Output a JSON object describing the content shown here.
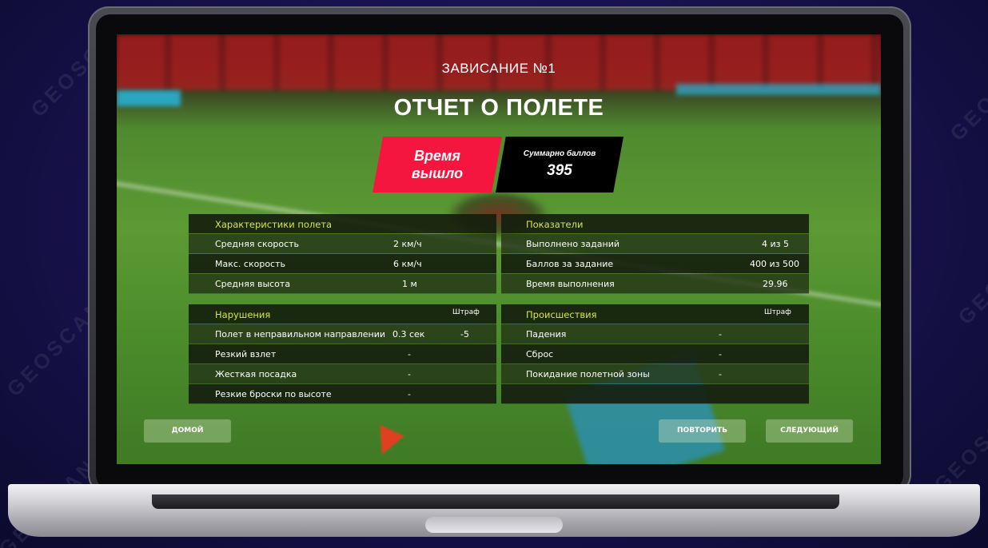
{
  "watermark": "GEOSCAN",
  "header": {
    "mission": "ЗАВИСАНИЕ №1",
    "title": "ОТЧЕТ О ПОЛЕТЕ"
  },
  "status": {
    "time_out_line1": "Время",
    "time_out_line2": "вышло",
    "score_label": "Суммарно баллов",
    "score_value": "395"
  },
  "flight_characteristics": {
    "header": "Характеристики полета",
    "rows": [
      {
        "label": "Средняя скорость",
        "value": "2 км/ч"
      },
      {
        "label": "Макс. скорость",
        "value": "6 км/ч"
      },
      {
        "label": "Средняя высота",
        "value": "1 м"
      }
    ]
  },
  "indicators": {
    "header": "Показатели",
    "rows": [
      {
        "label": "Выполнено заданий",
        "value": "4 из 5"
      },
      {
        "label": "Баллов за задание",
        "value": "400 из 500"
      },
      {
        "label": "Время выполнения",
        "value": "29.96"
      }
    ]
  },
  "violations": {
    "header": "Нарушения",
    "penalty_header": "Штраф",
    "rows": [
      {
        "label": "Полет в неправильном направлении",
        "value": "0.3 сек",
        "penalty": "-5"
      },
      {
        "label": "Резкий взлет",
        "value": "-",
        "penalty": ""
      },
      {
        "label": "Жесткая посадка",
        "value": "-",
        "penalty": ""
      },
      {
        "label": "Резкие броски по высоте",
        "value": "-",
        "penalty": ""
      }
    ]
  },
  "incidents": {
    "header": "Происшествия",
    "penalty_header": "Штраф",
    "rows": [
      {
        "label": "Падения",
        "value": "-"
      },
      {
        "label": "Сброс",
        "value": "-"
      },
      {
        "label": "Покидание полетной зоны",
        "value": "-"
      },
      {
        "label": "",
        "value": ""
      }
    ]
  },
  "buttons": {
    "home": "ДОМОЙ",
    "repeat": "ПОВТОРИТЬ",
    "next": "СЛЕДУЮЩИЙ"
  },
  "colors": {
    "accent_red": "#f5163f",
    "header_yellow": "#d6e64a",
    "background": "#1a1352"
  }
}
